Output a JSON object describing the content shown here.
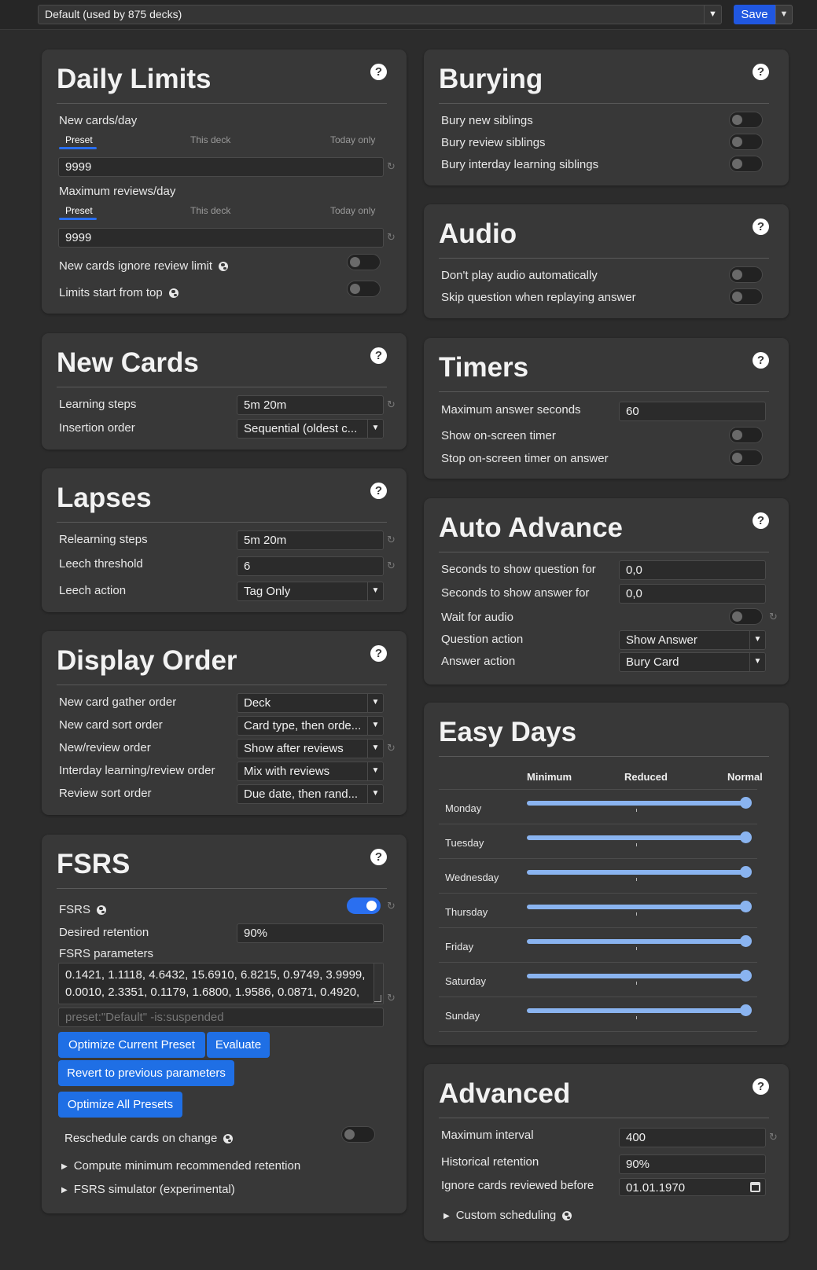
{
  "topbar": {
    "preset": "Default (used by 875 decks)",
    "save_label": "Save"
  },
  "help_glyph": "?",
  "revert_glyph": "↻",
  "daily_limits": {
    "title": "Daily Limits",
    "new_cards_label": "New cards/day",
    "tabs": [
      "Preset",
      "This deck",
      "Today only"
    ],
    "new_cards_value": "9999",
    "max_reviews_label": "Maximum reviews/day",
    "max_reviews_value": "9999",
    "ignore_review_limit_label": "New cards ignore review limit",
    "limits_from_top_label": "Limits start from top"
  },
  "new_cards": {
    "title": "New Cards",
    "learning_steps_label": "Learning steps",
    "learning_steps_value": "5m 20m",
    "insertion_order_label": "Insertion order",
    "insertion_order_value": "Sequential (oldest c..."
  },
  "lapses": {
    "title": "Lapses",
    "relearning_steps_label": "Relearning steps",
    "relearning_steps_value": "5m 20m",
    "leech_threshold_label": "Leech threshold",
    "leech_threshold_value": "6",
    "leech_action_label": "Leech action",
    "leech_action_value": "Tag Only"
  },
  "display_order": {
    "title": "Display Order",
    "rows": [
      {
        "label": "New card gather order",
        "value": "Deck"
      },
      {
        "label": "New card sort order",
        "value": "Card type, then orde..."
      },
      {
        "label": "New/review order",
        "value": "Show after reviews"
      },
      {
        "label": "Interday learning/review order",
        "value": "Mix with reviews"
      },
      {
        "label": "Review sort order",
        "value": "Due date, then rand..."
      }
    ]
  },
  "fsrs": {
    "title": "FSRS",
    "fsrs_label": "FSRS",
    "desired_retention_label": "Desired retention",
    "desired_retention_value": "90%",
    "params_label": "FSRS parameters",
    "params_line1": "0.1421, 1.1118, 4.6432, 15.6910, 6.8215, 0.9749, 3.9999,",
    "params_line2": "0.0010, 2.3351, 0.1179, 1.6800, 1.9586, 0.0871, 0.4920,",
    "search_placeholder": "preset:\"Default\" -is:suspended",
    "optimize_current": "Optimize Current Preset",
    "evaluate": "Evaluate",
    "revert_params": "Revert to previous parameters",
    "optimize_all": "Optimize All Presets",
    "reschedule_label": "Reschedule cards on change",
    "compute_min_label": "Compute minimum recommended retention",
    "simulator_label": "FSRS simulator (experimental)"
  },
  "burying": {
    "title": "Burying",
    "rows": [
      "Bury new siblings",
      "Bury review siblings",
      "Bury interday learning siblings"
    ]
  },
  "audio": {
    "title": "Audio",
    "rows": [
      "Don't play audio automatically",
      "Skip question when replaying answer"
    ]
  },
  "timers": {
    "title": "Timers",
    "max_answer_label": "Maximum answer seconds",
    "max_answer_value": "60",
    "show_timer_label": "Show on-screen timer",
    "stop_timer_label": "Stop on-screen timer on answer"
  },
  "auto_advance": {
    "title": "Auto Advance",
    "question_seconds_label": "Seconds to show question for",
    "question_seconds_value": "0,0",
    "answer_seconds_label": "Seconds to show answer for",
    "answer_seconds_value": "0,0",
    "wait_audio_label": "Wait for audio",
    "question_action_label": "Question action",
    "question_action_value": "Show Answer",
    "answer_action_label": "Answer action",
    "answer_action_value": "Bury Card"
  },
  "easy_days": {
    "title": "Easy Days",
    "headers": [
      "Minimum",
      "Reduced",
      "Normal"
    ],
    "days": [
      {
        "name": "Monday",
        "value": 1.0
      },
      {
        "name": "Tuesday",
        "value": 1.0
      },
      {
        "name": "Wednesday",
        "value": 1.0
      },
      {
        "name": "Thursday",
        "value": 1.0
      },
      {
        "name": "Friday",
        "value": 1.0
      },
      {
        "name": "Saturday",
        "value": 1.0
      },
      {
        "name": "Sunday",
        "value": 1.0
      }
    ]
  },
  "advanced": {
    "title": "Advanced",
    "max_interval_label": "Maximum interval",
    "max_interval_value": "400",
    "historical_retention_label": "Historical retention",
    "historical_retention_value": "90%",
    "ignore_before_label": "Ignore cards reviewed before",
    "ignore_before_value": "01.01.1970",
    "custom_scheduling_label": "Custom scheduling"
  }
}
